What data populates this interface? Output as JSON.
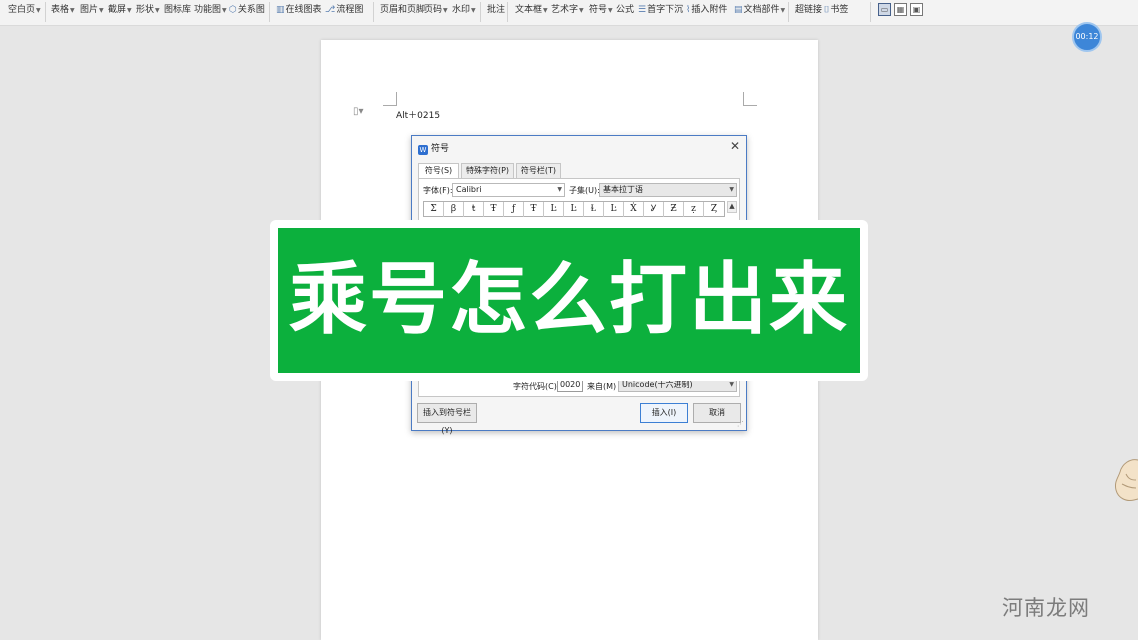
{
  "toolbar": {
    "blank_page": "空白页",
    "table": "表格",
    "picture": "图片",
    "screenshot": "截屏",
    "shape": "形状",
    "icon_library": "图标库",
    "function_chart": "功能图",
    "relation_chart": "关系图",
    "online_chart": "在线图表",
    "flowchart": "流程图",
    "header_footer": "页眉和页脚",
    "page_number": "页码",
    "watermark": "水印",
    "comment": "批注",
    "text_box": "文本框",
    "word_art": "艺术字",
    "symbol": "符号",
    "formula": "公式",
    "drop_cap": "首字下沉",
    "attachment": "插入附件",
    "doc_parts": "文档部件",
    "hyperlink": "超链接",
    "bookmark": "书签"
  },
  "timer": "00:12",
  "document": {
    "text": "Alt＋0215"
  },
  "dialog": {
    "title": "符号",
    "tabs": [
      "符号(S)",
      "特殊字符(P)",
      "符号栏(T)"
    ],
    "font_label": "字体(F):",
    "font_value": "Calibri",
    "subset_label": "子集(U):",
    "subset_value": "基本拉丁语",
    "symbols": [
      "Σ",
      "ꞵ",
      "ŧ",
      "Ŧ",
      "ƒ",
      "Ŧ",
      "Ŀ",
      "Ŀ",
      "Ɫ",
      "Ŀ",
      "Ẋ",
      "Ỿ",
      "Ƶ",
      "ẓ",
      "Ȥ"
    ],
    "char_code_label": "字符代码(C):",
    "char_code_value": "0020",
    "from_label": "来自(M)",
    "from_value": "Unicode(十六进制)",
    "insert_to_bar": "插入到符号栏(Y)",
    "insert": "插入(I)",
    "cancel": "取消"
  },
  "banner": {
    "text": "乘号怎么打出来"
  },
  "watermark_text": "河南龙网",
  "colors": {
    "banner_green": "#0cb03d",
    "accent_blue": "#3d86d8"
  }
}
